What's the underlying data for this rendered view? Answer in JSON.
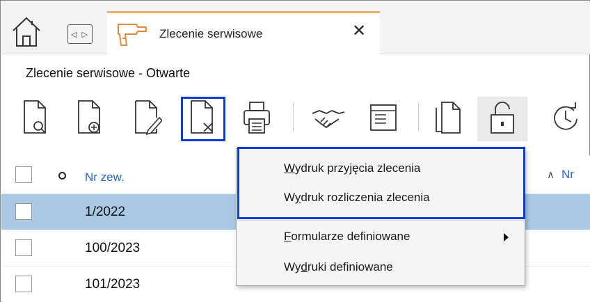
{
  "tab": {
    "label": "Zlecenie serwisowe",
    "close": "✕"
  },
  "nav": {
    "arrows": "◁ ▷"
  },
  "page_title": "Zlecenie serwisowe - Otwarte",
  "toolbar": {
    "items": [
      "preview-icon",
      "add-icon",
      "edit-icon",
      "delete-icon",
      "print-icon",
      "handshake-icon",
      "form-icon",
      "copy-icon",
      "lock-icon",
      "history-icon"
    ]
  },
  "grid": {
    "column_nr_zew": "Nr zew.",
    "column_nr_partial": "Nr",
    "sort_icon": "sort-up-icon",
    "rows": [
      {
        "nr_zew": "1/2022",
        "selected": true
      },
      {
        "nr_zew": "100/2023",
        "selected": false
      },
      {
        "nr_zew": "101/2023",
        "selected": false
      }
    ]
  },
  "context_menu": {
    "items": [
      {
        "pre": "",
        "accel": "W",
        "post": "ydruk przyjęcia zlecenia"
      },
      {
        "pre": "W",
        "accel": "y",
        "post": "druk rozliczenia zlecenia"
      },
      {
        "pre": "",
        "accel": "F",
        "post": "ormularze definiowane"
      },
      {
        "pre": "Wy",
        "accel": "d",
        "post": "ruki definiowane"
      }
    ]
  },
  "colors": {
    "highlight": "#0a3fd8",
    "link": "#2367c7",
    "selected_row": "#a9c8e4",
    "tab_accent": "#e6b56a"
  }
}
